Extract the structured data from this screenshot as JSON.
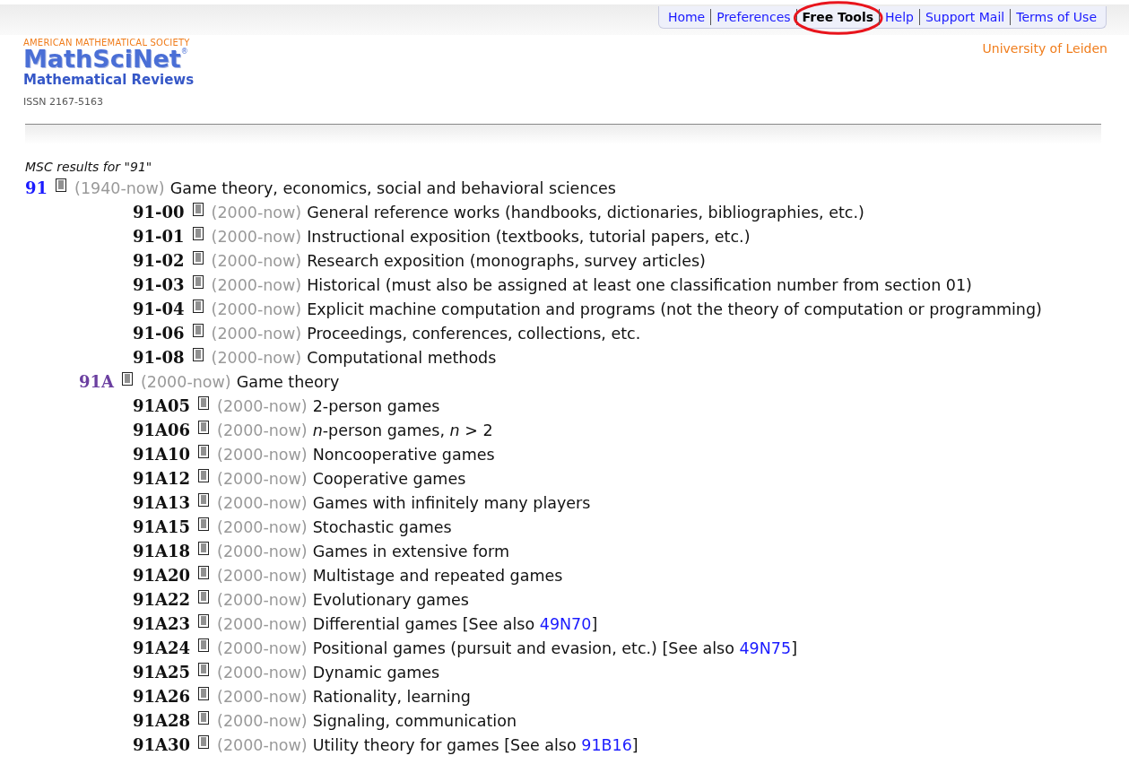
{
  "nav": [
    {
      "label": "Home",
      "selected": false,
      "highlighted": false
    },
    {
      "label": "Preferences",
      "selected": false,
      "highlighted": false
    },
    {
      "label": "Free Tools",
      "selected": true,
      "highlighted": true
    },
    {
      "label": "Help",
      "selected": false,
      "highlighted": false
    },
    {
      "label": "Support Mail",
      "selected": false,
      "highlighted": false
    },
    {
      "label": "Terms of Use",
      "selected": false,
      "highlighted": false
    }
  ],
  "logo": {
    "society": "AMERICAN MATHEMATICAL SOCIETY",
    "name": "MathSciNet",
    "reg": "®",
    "subtitle": "Mathematical Reviews",
    "issn": "ISSN 2167-5163"
  },
  "institution": "University of Leiden",
  "results_heading": "MSC results for \"91\"",
  "tree": [
    {
      "kind": "root",
      "code": "91",
      "years": "(1940-now)",
      "parts": [
        {
          "kind": "text",
          "text": "Game theory, economics, social and behavioral sciences"
        }
      ],
      "children": [
        {
          "kind": "leaf",
          "code": "91-00",
          "years": "(2000-now)",
          "parts": [
            {
              "kind": "text",
              "text": "General reference works (handbooks, dictionaries, bibliographies, etc.)"
            }
          ]
        },
        {
          "kind": "leaf",
          "code": "91-01",
          "years": "(2000-now)",
          "parts": [
            {
              "kind": "text",
              "text": "Instructional exposition (textbooks, tutorial papers, etc.)"
            }
          ]
        },
        {
          "kind": "leaf",
          "code": "91-02",
          "years": "(2000-now)",
          "parts": [
            {
              "kind": "text",
              "text": "Research exposition (monographs, survey articles)"
            }
          ]
        },
        {
          "kind": "leaf",
          "code": "91-03",
          "years": "(2000-now)",
          "parts": [
            {
              "kind": "text",
              "text": "Historical (must also be assigned at least one classification number from section 01)"
            }
          ]
        },
        {
          "kind": "leaf",
          "code": "91-04",
          "years": "(2000-now)",
          "parts": [
            {
              "kind": "text",
              "text": "Explicit machine computation and programs (not the theory of computation or programming)"
            }
          ]
        },
        {
          "kind": "leaf",
          "code": "91-06",
          "years": "(2000-now)",
          "parts": [
            {
              "kind": "text",
              "text": "Proceedings, conferences, collections, etc."
            }
          ]
        },
        {
          "kind": "leaf",
          "code": "91-08",
          "years": "(2000-now)",
          "parts": [
            {
              "kind": "text",
              "text": "Computational methods"
            }
          ]
        },
        {
          "kind": "section",
          "code": "91A",
          "years": "(2000-now)",
          "parts": [
            {
              "kind": "text",
              "text": "Game theory"
            }
          ],
          "children": [
            {
              "kind": "leaf",
              "code": "91A05",
              "years": "(2000-now)",
              "parts": [
                {
                  "kind": "text",
                  "text": "2-person games"
                }
              ]
            },
            {
              "kind": "leaf",
              "code": "91A06",
              "years": "(2000-now)",
              "parts": [
                {
                  "kind": "text",
                  "text": "*n*-person games, *n* > 2"
                }
              ]
            },
            {
              "kind": "leaf",
              "code": "91A10",
              "years": "(2000-now)",
              "parts": [
                {
                  "kind": "text",
                  "text": "Noncooperative games"
                }
              ]
            },
            {
              "kind": "leaf",
              "code": "91A12",
              "years": "(2000-now)",
              "parts": [
                {
                  "kind": "text",
                  "text": "Cooperative games"
                }
              ]
            },
            {
              "kind": "leaf",
              "code": "91A13",
              "years": "(2000-now)",
              "parts": [
                {
                  "kind": "text",
                  "text": "Games with infinitely many players"
                }
              ]
            },
            {
              "kind": "leaf",
              "code": "91A15",
              "years": "(2000-now)",
              "parts": [
                {
                  "kind": "text",
                  "text": "Stochastic games"
                }
              ]
            },
            {
              "kind": "leaf",
              "code": "91A18",
              "years": "(2000-now)",
              "parts": [
                {
                  "kind": "text",
                  "text": "Games in extensive form"
                }
              ]
            },
            {
              "kind": "leaf",
              "code": "91A20",
              "years": "(2000-now)",
              "parts": [
                {
                  "kind": "text",
                  "text": "Multistage and repeated games"
                }
              ]
            },
            {
              "kind": "leaf",
              "code": "91A22",
              "years": "(2000-now)",
              "parts": [
                {
                  "kind": "text",
                  "text": "Evolutionary games"
                }
              ]
            },
            {
              "kind": "leaf",
              "code": "91A23",
              "years": "(2000-now)",
              "parts": [
                {
                  "kind": "text",
                  "text": "Differential games [See also "
                },
                {
                  "kind": "link",
                  "text": "49N70"
                },
                {
                  "kind": "text",
                  "text": "]"
                }
              ]
            },
            {
              "kind": "leaf",
              "code": "91A24",
              "years": "(2000-now)",
              "parts": [
                {
                  "kind": "text",
                  "text": "Positional games (pursuit and evasion, etc.) [See also "
                },
                {
                  "kind": "link",
                  "text": "49N75"
                },
                {
                  "kind": "text",
                  "text": "]"
                }
              ]
            },
            {
              "kind": "leaf",
              "code": "91A25",
              "years": "(2000-now)",
              "parts": [
                {
                  "kind": "text",
                  "text": "Dynamic games"
                }
              ]
            },
            {
              "kind": "leaf",
              "code": "91A26",
              "years": "(2000-now)",
              "parts": [
                {
                  "kind": "text",
                  "text": "Rationality, learning"
                }
              ]
            },
            {
              "kind": "leaf",
              "code": "91A28",
              "years": "(2000-now)",
              "parts": [
                {
                  "kind": "text",
                  "text": "Signaling, communication"
                }
              ]
            },
            {
              "kind": "leaf",
              "code": "91A30",
              "years": "(2000-now)",
              "parts": [
                {
                  "kind": "text",
                  "text": "Utility theory for games [See also "
                },
                {
                  "kind": "link",
                  "text": "91B16"
                },
                {
                  "kind": "text",
                  "text": "]"
                }
              ]
            }
          ]
        }
      ]
    }
  ]
}
